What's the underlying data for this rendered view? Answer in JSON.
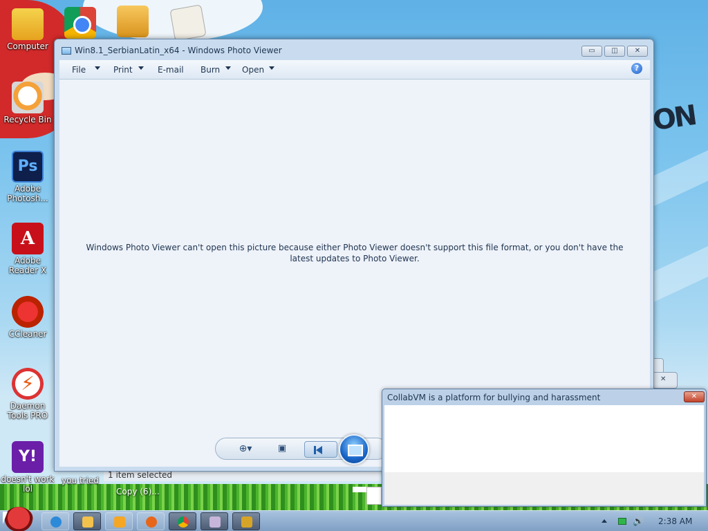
{
  "desktop": {
    "icons": [
      {
        "label": "Computer",
        "icon": "computer-icon"
      },
      {
        "label": "Recycle Bin",
        "icon": "recycle-bin-icon"
      },
      {
        "label": "Adobe Photosh...",
        "icon": "photoshop-icon"
      },
      {
        "label": "Adobe Reader X",
        "icon": "adobe-reader-icon"
      },
      {
        "label": "CCleaner",
        "icon": "ccleaner-icon"
      },
      {
        "label": "Daemon Tools PRO",
        "icon": "daemon-tools-icon"
      },
      {
        "label": "doesn't work lol",
        "icon": "yahoo-icon"
      },
      {
        "label": "you tried",
        "icon": "blank-icon"
      }
    ],
    "top_icons": [
      "chrome-icon",
      "folder-icon",
      "documents-icon"
    ],
    "wallpaper_text": "ON"
  },
  "photo_viewer": {
    "title": "Win8.1_SerbianLatin_x64 - Windows Photo Viewer",
    "menu": [
      {
        "label": "File",
        "has_arrow": true
      },
      {
        "label": "Print",
        "has_arrow": true
      },
      {
        "label": "E-mail",
        "has_arrow": false
      },
      {
        "label": "Burn",
        "has_arrow": true
      },
      {
        "label": "Open",
        "has_arrow": true
      }
    ],
    "help_label": "?",
    "message": "Windows Photo Viewer can't open this picture because either Photo Viewer doesn't support this file format, or you don't have the latest updates to Photo Viewer.",
    "window_buttons": {
      "minimize": "▭",
      "maximize": "◫",
      "close": "✕"
    }
  },
  "explorer": {
    "status": "1 item selected",
    "copy_label": "Copy (6)..."
  },
  "dialog": {
    "title": "CollabVM is a platform for bullying and harassment",
    "close_label": "✕"
  },
  "taskbar": {
    "clock": "2:38 AM",
    "volume_glyph": "🔊"
  },
  "colors": {
    "window_frame": "#c9dcef",
    "content_bg": "#eef2f9",
    "text": "#1e3450",
    "close_red": "#c3432b"
  }
}
